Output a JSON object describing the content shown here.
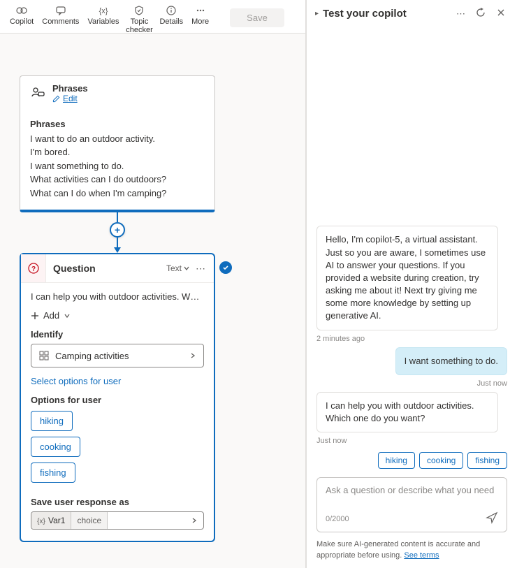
{
  "toolbar": {
    "items": [
      {
        "label": "Copilot"
      },
      {
        "label": "Comments"
      },
      {
        "label": "Variables"
      },
      {
        "label": "Topic checker"
      },
      {
        "label": "Details"
      },
      {
        "label": "More"
      }
    ],
    "save_label": "Save"
  },
  "phrases_card": {
    "title": "Phrases",
    "edit_label": "Edit",
    "section_title": "Phrases",
    "lines": [
      "I want to do an outdoor activity.",
      "I'm bored.",
      "I want something to do.",
      "What activities can I do outdoors?",
      "What can I do when I'm camping?"
    ]
  },
  "question_card": {
    "title": "Question",
    "type_label": "Text",
    "prompt": "I can help you with outdoor activities. Which…",
    "add_label": "Add",
    "identify_label": "Identify",
    "identify_value": "Camping activities",
    "select_options_link": "Select options for user",
    "options_label": "Options for user",
    "options": [
      "hiking",
      "cooking",
      "fishing"
    ],
    "save_as_label": "Save user response as",
    "var_name": "Var1",
    "var_type": "choice"
  },
  "test_panel": {
    "title": "Test your copilot",
    "bot_greeting": "Hello, I'm copilot-5, a virtual assistant. Just so you are aware, I sometimes use AI to answer your questions. If you provided a website during creation, try asking me about it! Next try giving me some more knowledge by setting up generative AI.",
    "bot_greeting_time": "2 minutes ago",
    "user_msg": "I want something to do.",
    "user_msg_time": "Just now",
    "bot_reply": "I can help you with outdoor activities. Which one do you want?",
    "bot_reply_time": "Just now",
    "suggestions": [
      "hiking",
      "cooking",
      "fishing"
    ],
    "input_placeholder": "Ask a question or describe what you need",
    "counter": "0/2000",
    "disclaimer_text": "Make sure AI-generated content is accurate and appropriate before using. ",
    "disclaimer_link": "See terms"
  }
}
